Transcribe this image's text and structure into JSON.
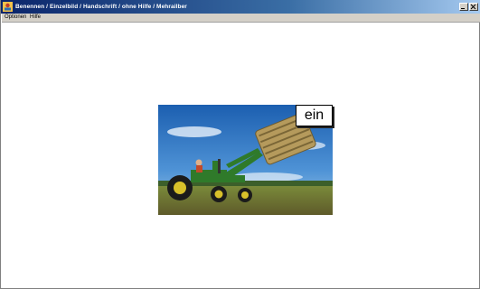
{
  "window": {
    "title": "Benennen / Einzelbild / Handschrift / ohne Hilfe / Mehrailber",
    "controls": [
      "minimize",
      "close"
    ]
  },
  "menu": {
    "items": [
      {
        "label": "Optionen",
        "accel": "O"
      },
      {
        "label": "Hilfe",
        "accel": "H"
      }
    ]
  },
  "content": {
    "image": {
      "description_icon": "tractor-with-hay-bale-photo",
      "label": "ein"
    }
  },
  "colors": {
    "titlebar_start": "#0a246a",
    "titlebar_end": "#a6caf0",
    "menubar": "#d4d0c8"
  }
}
